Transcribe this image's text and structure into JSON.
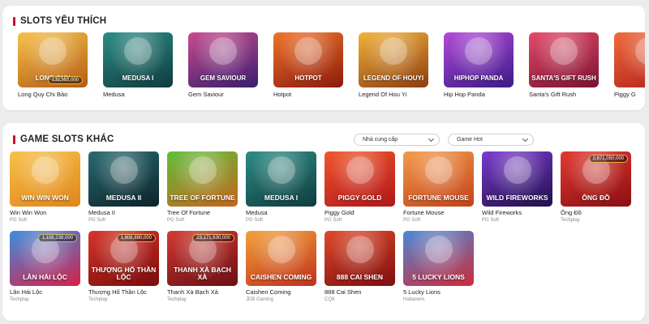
{
  "favorites": {
    "title": "SLOTS YÊU THÍCH",
    "items": [
      {
        "name": "Long Quy Chi Bảo",
        "art_text": "LONG QUY",
        "jackpot": "132,392,000",
        "bg": [
          "#f6c24a",
          "#b45a12"
        ],
        "icon": "dragon-turtle-icon"
      },
      {
        "name": "Medusa",
        "art_text": "MEDUSA I",
        "jackpot": "",
        "bg": [
          "#2c8c86",
          "#0f3c3f"
        ],
        "icon": "medusa-icon"
      },
      {
        "name": "Gem Saviour",
        "art_text": "GEM SAVIOUR",
        "jackpot": "",
        "bg": [
          "#c84b8f",
          "#3a1d6e"
        ],
        "icon": "hero-icon"
      },
      {
        "name": "Hotpot",
        "art_text": "HOTPOT",
        "jackpot": "",
        "bg": [
          "#f0742a",
          "#8c1a0c"
        ],
        "icon": "hotpot-icon"
      },
      {
        "name": "Legend Of Hou Yi",
        "art_text": "LEGEND OF HOUYI",
        "jackpot": "",
        "bg": [
          "#f2b23a",
          "#8c3d10"
        ],
        "icon": "archer-icon"
      },
      {
        "name": "Hip Hop Panda",
        "art_text": "HIPHOP PANDA",
        "jackpot": "",
        "bg": [
          "#b44ad9",
          "#3b1a86"
        ],
        "icon": "panda-icon"
      },
      {
        "name": "Santa's Gift Rush",
        "art_text": "SANTA'S GIFT RUSH",
        "jackpot": "",
        "bg": [
          "#e44a6a",
          "#7a1230"
        ],
        "icon": "santa-icon"
      },
      {
        "name": "Piggy G",
        "art_text": "",
        "jackpot": "",
        "bg": [
          "#f06a3a",
          "#b2201a"
        ],
        "icon": "piggy-icon"
      }
    ]
  },
  "other_games": {
    "title": "GAME SLOTS KHÁC",
    "filters": {
      "provider": "Nhà cung cấp",
      "sort": "Game Hot"
    },
    "items": [
      {
        "name": "Win Win Won",
        "provider": "PG Soft",
        "art_text": "WIN WIN WON",
        "jackpot": "",
        "bg": [
          "#f7c14a",
          "#e0851a"
        ],
        "icon": "shiba-icon"
      },
      {
        "name": "Medusa II",
        "provider": "PG Soft",
        "art_text": "MEDUSA II",
        "jackpot": "",
        "bg": [
          "#2a6a72",
          "#0c2329"
        ],
        "icon": "medusa-icon"
      },
      {
        "name": "Tree Of Fortune",
        "provider": "PG Soft",
        "art_text": "TREE OF FORTUNE",
        "jackpot": "",
        "bg": [
          "#5fbf3a",
          "#c7641c"
        ],
        "icon": "tree-icon"
      },
      {
        "name": "Medusa",
        "provider": "PG Soft",
        "art_text": "MEDUSA I",
        "jackpot": "",
        "bg": [
          "#2c8c86",
          "#0f3c3f"
        ],
        "icon": "medusa-icon"
      },
      {
        "name": "Piggy Gold",
        "provider": "PG Soft",
        "art_text": "PIGGY GOLD",
        "jackpot": "",
        "bg": [
          "#f0562a",
          "#b0161a"
        ],
        "icon": "piggy-icon"
      },
      {
        "name": "Fortune Mouse",
        "provider": "PG Soft",
        "art_text": "FORTUNE MOUSE",
        "jackpot": "",
        "bg": [
          "#f39b4a",
          "#c2421c"
        ],
        "icon": "mouse-icon"
      },
      {
        "name": "Wild Fireworks",
        "provider": "PG Soft",
        "art_text": "WILD FIREWORKS",
        "jackpot": "",
        "bg": [
          "#7a3ad0",
          "#20104a"
        ],
        "icon": "fireworks-icon"
      },
      {
        "name": "Ông Đồ",
        "provider": "Techplay",
        "art_text": "ÔNG ĐỒ",
        "jackpot": "2,671,050,000",
        "bg": [
          "#e23a30",
          "#8a0e12"
        ],
        "icon": "scholar-icon"
      },
      {
        "name": "Lân Hái Lộc",
        "provider": "Techplay",
        "art_text": "LÂN HÁI LỘC",
        "jackpot": "1,108,238,000",
        "bg": [
          "#3b8fe0",
          "#d6204a"
        ],
        "icon": "lion-dance-icon"
      },
      {
        "name": "Thượng Hổ Thần Lộc",
        "provider": "Techplay",
        "art_text": "THƯỢNG HỔ THẦN LỘC",
        "jackpot": "1,806,880,000",
        "bg": [
          "#d8342a",
          "#7a0c0c"
        ],
        "icon": "tiger-icon"
      },
      {
        "name": "Thanh Xà Bạch Xà",
        "provider": "Techplay",
        "art_text": "THANH XÀ BẠCH XÀ",
        "jackpot": "23,171,630,000",
        "bg": [
          "#d33a32",
          "#6a0f14"
        ],
        "icon": "snake-icon"
      },
      {
        "name": "Caishen Coming",
        "provider": "JDB Gaming",
        "art_text": "CAISHEN COMING",
        "jackpot": "",
        "bg": [
          "#f2a23a",
          "#c0301c"
        ],
        "icon": "caishen-icon"
      },
      {
        "name": "888 Cai Shen",
        "provider": "CQ9",
        "art_text": "888 CAI SHEN",
        "jackpot": "",
        "bg": [
          "#e0482a",
          "#7e0e0e"
        ],
        "icon": "caishen-icon"
      },
      {
        "name": "5 Lucky Lions",
        "provider": "Habanero",
        "art_text": "5 LUCKY LIONS",
        "jackpot": "",
        "bg": [
          "#4a8ad8",
          "#cf2a3a"
        ],
        "icon": "lion-icon"
      }
    ]
  }
}
